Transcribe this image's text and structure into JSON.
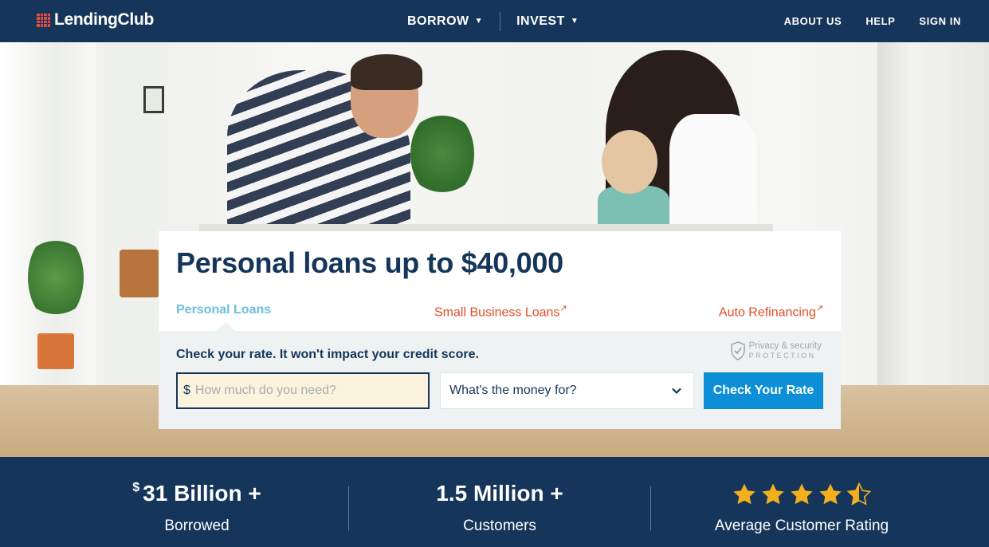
{
  "header": {
    "logo_text": "LendingClub",
    "nav_main": [
      {
        "label": "BORROW"
      },
      {
        "label": "INVEST"
      }
    ],
    "nav_right": [
      {
        "label": "ABOUT US"
      },
      {
        "label": "HELP"
      },
      {
        "label": "SIGN IN"
      }
    ]
  },
  "card": {
    "title": "Personal loans up to $40,000",
    "tabs": [
      {
        "label": "Personal Loans",
        "active": true
      },
      {
        "label": "Small Business Loans",
        "external": true
      },
      {
        "label": "Auto Refinancing",
        "external": true
      }
    ],
    "check_text": "Check your rate. It won't impact your credit score.",
    "privacy_line1": "Privacy & security",
    "privacy_line2": "PROTECTION",
    "amount_prefix": "$",
    "amount_placeholder": "How much do you need?",
    "purpose_selected": "What's the money for?",
    "cta_label": "Check Your Rate"
  },
  "stats": [
    {
      "currency": "$",
      "value": "31 Billion +",
      "label": "Borrowed"
    },
    {
      "value": "1.5 Million +",
      "label": "Customers"
    },
    {
      "rating": 4.5,
      "max": 5,
      "label": "Average Customer Rating"
    }
  ],
  "colors": {
    "navy": "#15365a",
    "accent_blue": "#0c8fd6",
    "tab_active": "#6cc0dd",
    "tab_link": "#e34c26",
    "logo_red": "#e8473b",
    "star": "#f2b01e",
    "input_bg": "#fcf3de"
  }
}
